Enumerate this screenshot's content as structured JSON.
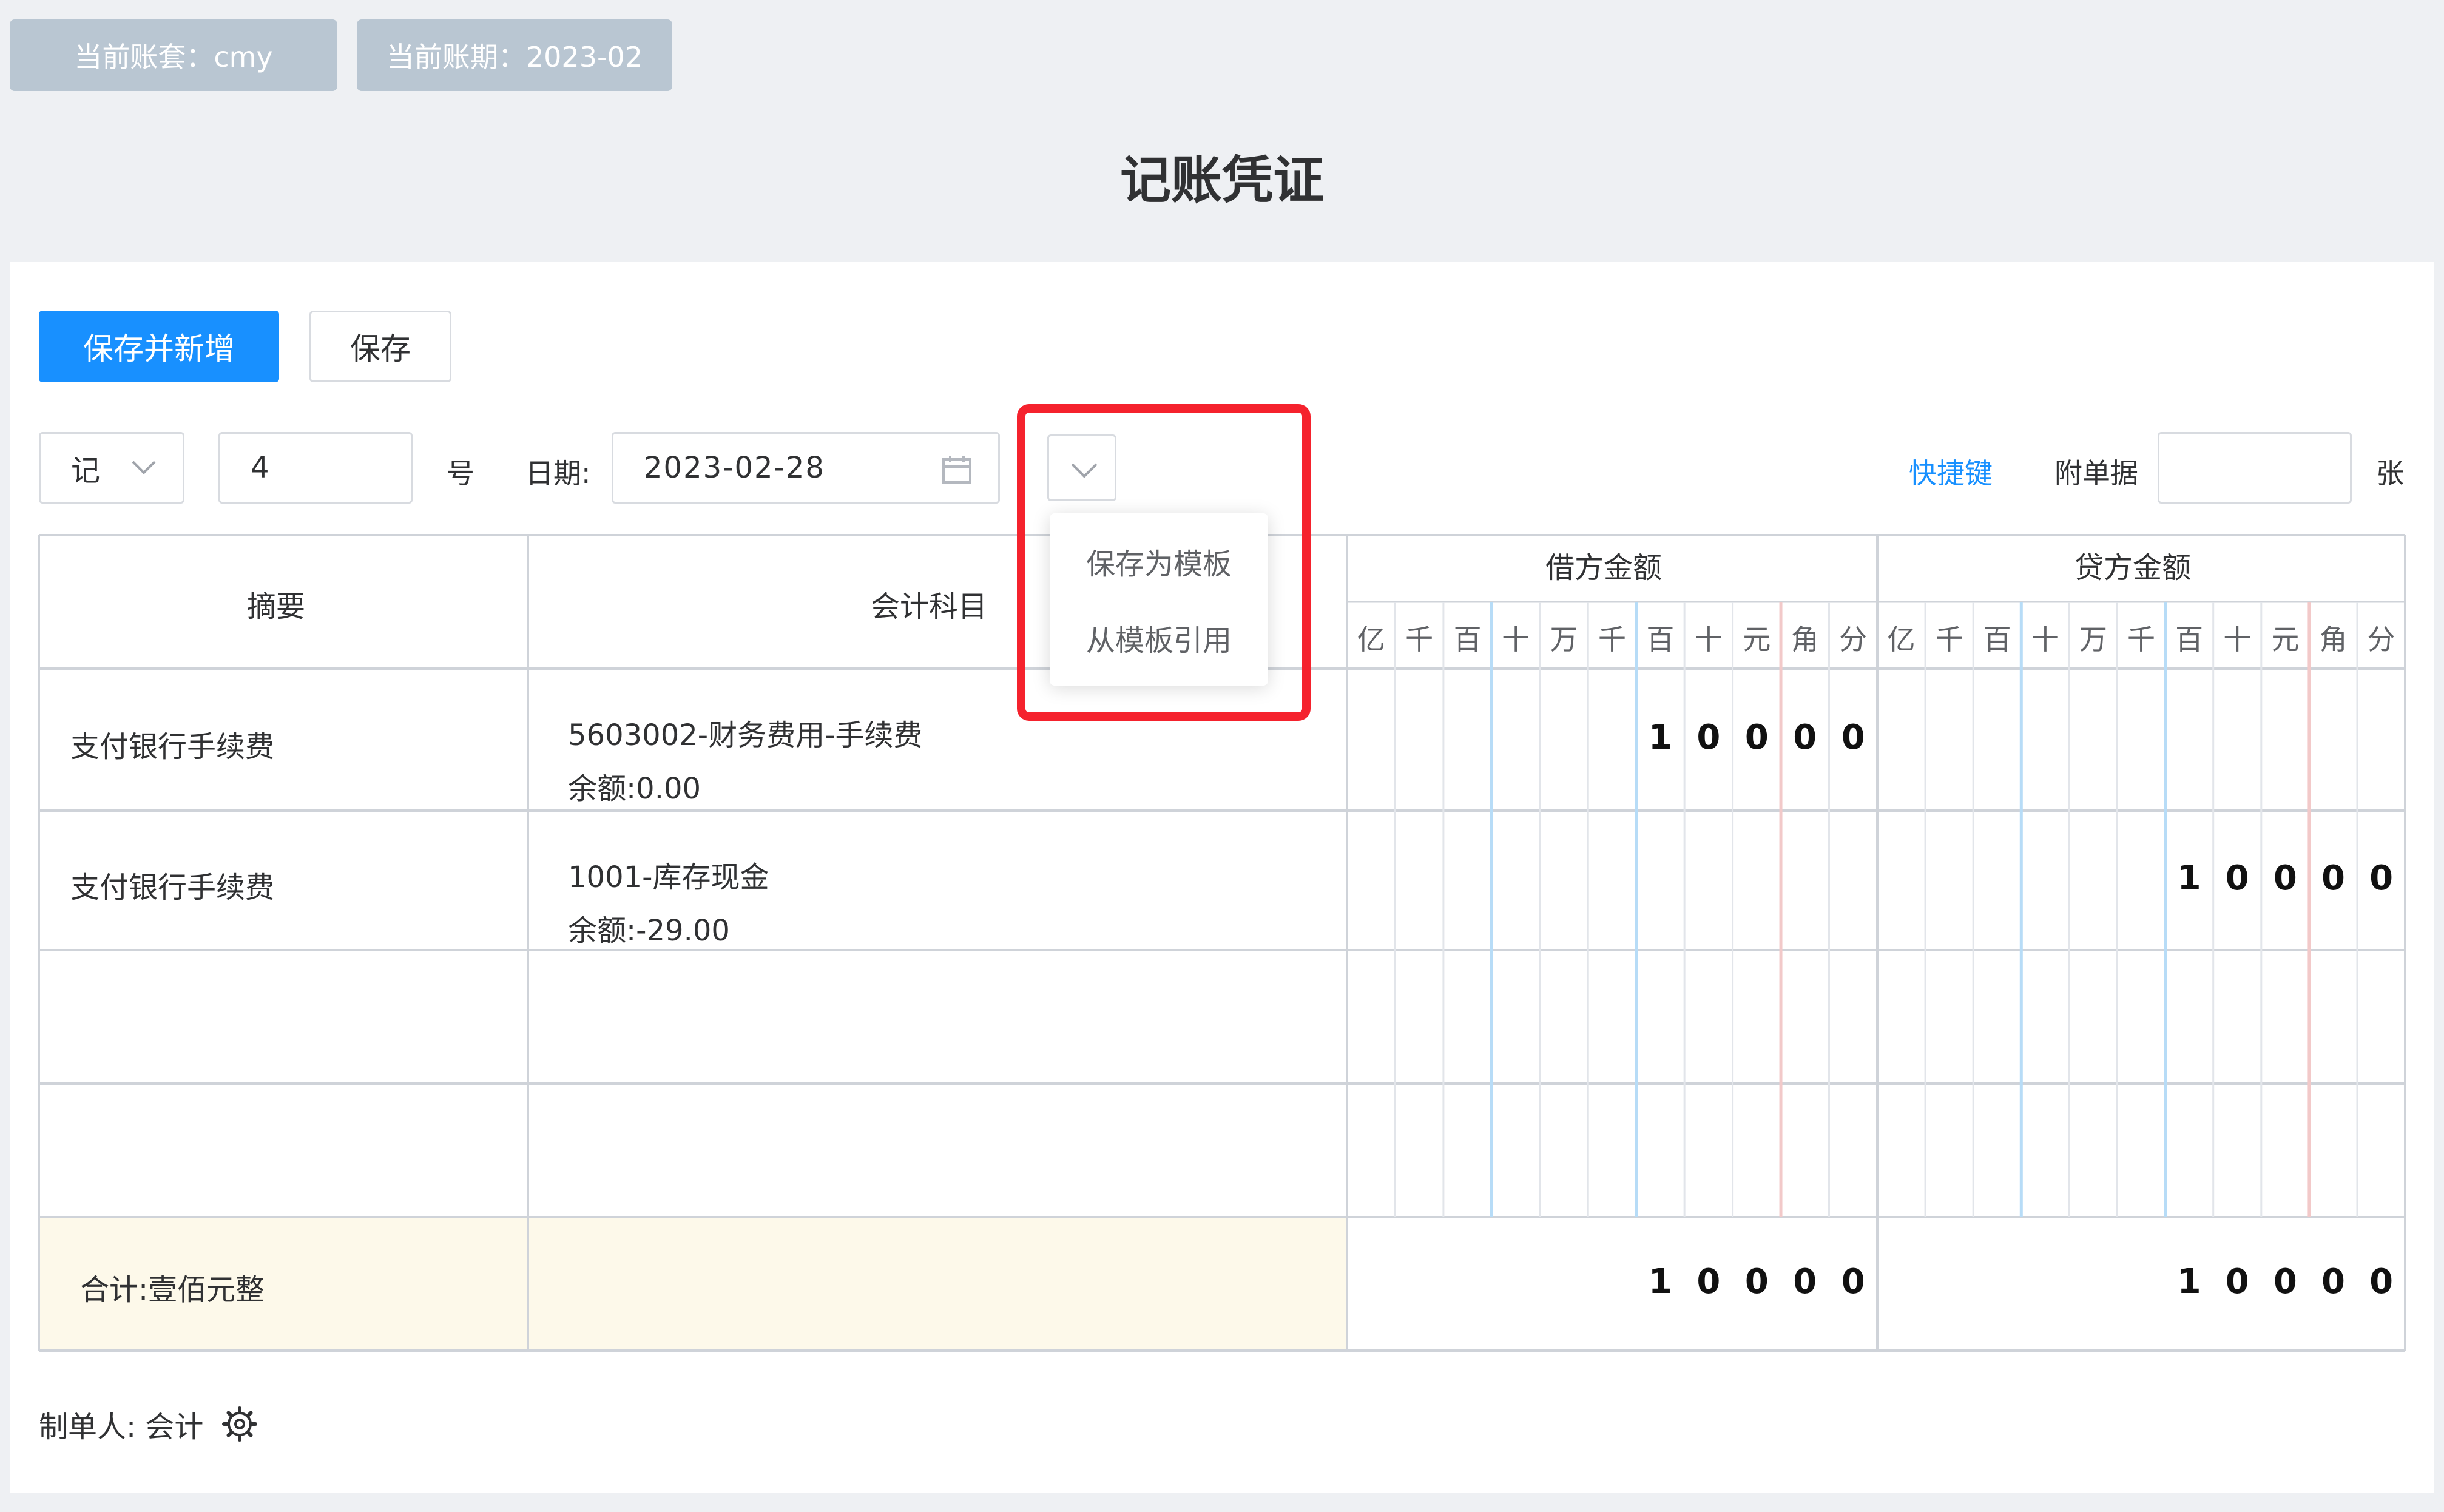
{
  "header": {
    "account_set": "当前账套：cmy",
    "period": "当前账期：2023-02",
    "title": "记账凭证"
  },
  "toolbar": {
    "save_and_new": "保存并新增",
    "save": "保存"
  },
  "voucher": {
    "word": "记",
    "number": "4",
    "number_suffix": "号",
    "date_label": "日期:",
    "date_value": "2023-02-28",
    "shortcut": "快捷键",
    "attach_label": "附单据",
    "attach_value": "",
    "attach_suffix": "张"
  },
  "template_menu": {
    "items": [
      "保存为模板",
      "从模板引用"
    ]
  },
  "table": {
    "col_summary": "摘要",
    "col_subject": "会计科目",
    "col_debit": "借方金额",
    "col_credit": "贷方金额",
    "digit_headers": [
      "亿",
      "千",
      "百",
      "十",
      "万",
      "千",
      "百",
      "十",
      "元",
      "角",
      "分"
    ],
    "rows": [
      {
        "summary": "支付银行手续费",
        "subject": "5603002-财务费用-手续费",
        "balance": "余额:0.00",
        "debit": [
          "",
          "",
          "",
          "",
          "",
          "",
          "1",
          "0",
          "0",
          "0",
          "0"
        ],
        "credit": [
          "",
          "",
          "",
          "",
          "",
          "",
          "",
          "",
          "",
          "",
          ""
        ]
      },
      {
        "summary": "支付银行手续费",
        "subject": "1001-库存现金",
        "balance": "余额:-29.00",
        "debit": [
          "",
          "",
          "",
          "",
          "",
          "",
          "",
          "",
          "",
          "",
          ""
        ],
        "credit": [
          "",
          "",
          "",
          "",
          "",
          "",
          "1",
          "0",
          "0",
          "0",
          "0"
        ]
      },
      {
        "summary": "",
        "subject": "",
        "balance": "",
        "debit": [
          "",
          "",
          "",
          "",
          "",
          "",
          "",
          "",
          "",
          "",
          ""
        ],
        "credit": [
          "",
          "",
          "",
          "",
          "",
          "",
          "",
          "",
          "",
          "",
          ""
        ]
      },
      {
        "summary": "",
        "subject": "",
        "balance": "",
        "debit": [
          "",
          "",
          "",
          "",
          "",
          "",
          "",
          "",
          "",
          "",
          ""
        ],
        "credit": [
          "",
          "",
          "",
          "",
          "",
          "",
          "",
          "",
          "",
          "",
          ""
        ]
      }
    ],
    "total_label": "合计:壹佰元整",
    "total_debit": [
      "",
      "",
      "",
      "",
      "",
      "",
      "1",
      "0",
      "0",
      "0",
      "0"
    ],
    "total_credit": [
      "",
      "",
      "",
      "",
      "",
      "",
      "1",
      "0",
      "0",
      "0",
      "0"
    ]
  },
  "footer": {
    "maker": "制单人: 会计"
  },
  "colors": {
    "primary": "#1890ff",
    "highlight": "#f5222d",
    "total_bg": "#fdf9ea",
    "tag_bg": "#b9c6d2"
  }
}
